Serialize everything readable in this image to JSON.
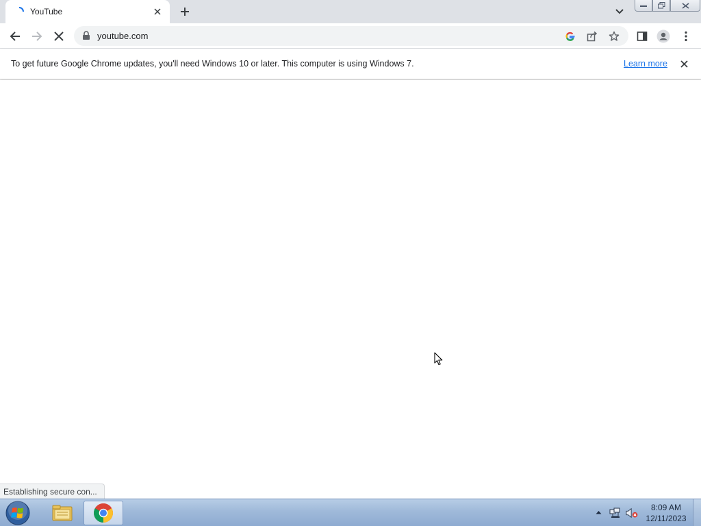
{
  "browser": {
    "tab": {
      "title": "YouTube",
      "favicon": "loading-spinner-icon",
      "close": "close-icon"
    },
    "new_tab": "plus-icon",
    "tab_search": "chevron-down-icon",
    "window_controls": [
      "minimize-icon",
      "restore-icon",
      "close-icon"
    ]
  },
  "toolbar": {
    "back": "arrow-left-icon",
    "forward": "arrow-right-icon",
    "stop": "close-icon",
    "url": "youtube.com",
    "lock": "lock-icon",
    "google_lens": "google-g-icon",
    "share": "share-icon",
    "bookmark": "star-icon",
    "side_panel": "side-panel-icon",
    "profile": "profile-icon",
    "menu": "kebab-menu-icon"
  },
  "infobar": {
    "message": "To get future Google Chrome updates, you'll need Windows 10 or later. This computer is using Windows 7.",
    "link": "Learn more"
  },
  "status_bubble": "Establishing secure con...",
  "taskbar": {
    "apps": [
      "windows-start-icon",
      "file-explorer-icon",
      "chrome-icon"
    ],
    "time": "8:09 AM",
    "date": "12/11/2023"
  },
  "colors": {
    "accent": "#1a73e8",
    "tabstrip": "#dee1e6",
    "omnibox": "#f1f3f4",
    "taskbar": "#9fb9d9"
  }
}
